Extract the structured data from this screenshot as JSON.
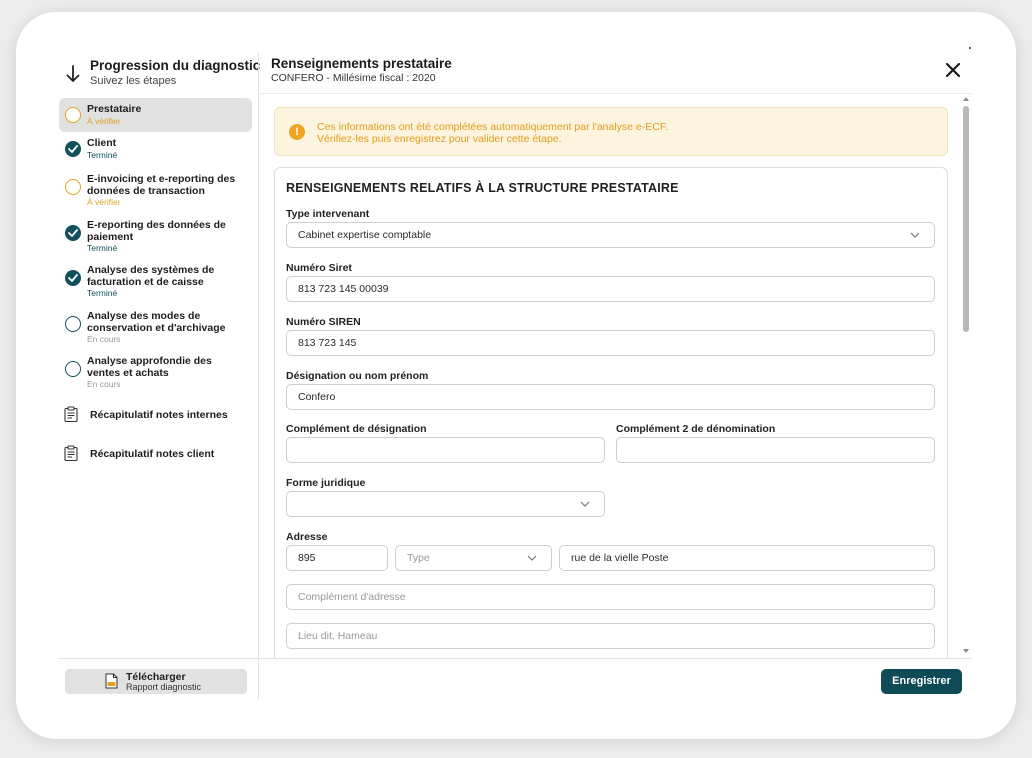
{
  "sidebar": {
    "title": "Progression du diagnostic",
    "subtitle": "Suivez les étapes",
    "steps": [
      {
        "label_lines": [
          "Prestataire"
        ],
        "status": "À vérifier",
        "state": "pending",
        "active": true
      },
      {
        "label_lines": [
          "Client"
        ],
        "status": "Terminé",
        "state": "done",
        "active": false
      },
      {
        "label_lines": [
          "E-invoicing et e-reporting des",
          "données de transaction"
        ],
        "status": "À vérifier",
        "state": "pending",
        "active": false
      },
      {
        "label_lines": [
          "E-reporting des données de",
          "paiement"
        ],
        "status": "Terminé",
        "state": "done",
        "active": false
      },
      {
        "label_lines": [
          "Analyse des systèmes de",
          "facturation et de caisse"
        ],
        "status": "Terminé",
        "state": "done",
        "active": false
      },
      {
        "label_lines": [
          "Analyse des modes de",
          "conservation et d'archivage"
        ],
        "status": "En cours",
        "state": "progress",
        "active": false
      },
      {
        "label_lines": [
          "Analyse approfondie des",
          "ventes et achats"
        ],
        "status": "En cours",
        "state": "progress",
        "active": false
      }
    ],
    "recaps": [
      {
        "label": "Récapitulatif notes internes",
        "icon": "clipboard-icon"
      },
      {
        "label": "Récapitulatif notes client",
        "icon": "clipboard-icon"
      }
    ],
    "download": {
      "label": "Télécharger",
      "sublabel": "Rapport diagnostic",
      "icon": "pdf-file-icon"
    }
  },
  "main": {
    "title": "Renseignements prestataire",
    "subtitle": "CONFERO - Millésime fiscal : 2020",
    "alert": {
      "icon": "warning-icon",
      "line1": "Ces informations ont été complétées automatiquement par l'analyse e-ECF.",
      "line2": "Vérifiez-les puis enregistrez pour valider cette étape."
    },
    "section_title": "RENSEIGNEMENTS RELATIFS À LA STRUCTURE PRESTATAIRE",
    "fields": {
      "type_intervenant": {
        "label": "Type intervenant",
        "value": "Cabinet expertise comptable"
      },
      "siret": {
        "label": "Numéro Siret",
        "value": "813 723 145 00039"
      },
      "siren": {
        "label": "Numéro SIREN",
        "value": "813 723 145"
      },
      "designation": {
        "label": "Désignation ou nom prénom",
        "value": "Confero"
      },
      "complement_designation": {
        "label": "Complément de désignation",
        "value": ""
      },
      "complement2_denomination": {
        "label": "Complément 2 de dénomination",
        "value": ""
      },
      "forme_juridique": {
        "label": "Forme juridique",
        "value": ""
      },
      "adresse": {
        "label": "Adresse",
        "numero": "895",
        "type_placeholder": "Type",
        "voie": "rue de la vielle Poste",
        "complement_placeholder": "Complément d'adresse",
        "lieu_dit_placeholder": "Lieu dit, Hameau"
      }
    },
    "save_label": "Enregistrer"
  },
  "colors": {
    "accent": "#0f4a57",
    "pending": "#e0a422",
    "alert_bg": "#fdf4e0",
    "alert_text": "#e39c1b"
  }
}
